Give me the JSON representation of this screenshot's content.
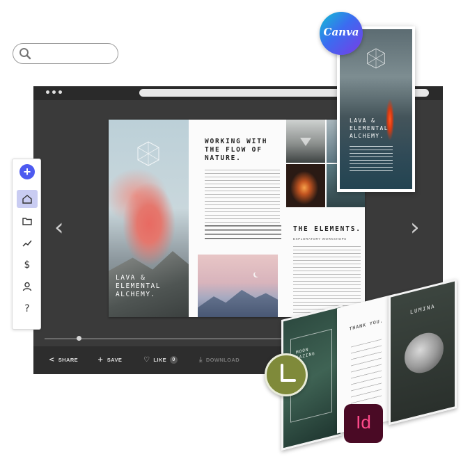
{
  "search": {
    "placeholder": ""
  },
  "spread": {
    "left_caption": [
      "LAVA &",
      "ELEMENTAL",
      "ALCHEMY."
    ],
    "heading": [
      "WORKING WITH",
      "THE FLOW OF",
      "NATURE."
    ],
    "section_title": "THE ELEMENTS.",
    "section_kicker": "EXPLORATORY WORKSHOPS"
  },
  "canva_card": {
    "caption": [
      "LAVA &",
      "ELEMENTAL",
      "ALCHEMY."
    ]
  },
  "badges": {
    "canva": "Canva",
    "indesign": "Id"
  },
  "actions": {
    "share": "SHARE",
    "save": "SAVE",
    "like": "LIKE",
    "like_count": "0",
    "download": "DOWNLOAD"
  },
  "brochure": {
    "panel1_title": [
      "MOON",
      "GAZING"
    ],
    "panel2_title": "THANK YOU.",
    "panel3_title": "LUMINA"
  },
  "icons": {
    "search": "search-icon",
    "add": "plus-icon",
    "home": "home-icon",
    "folder": "folder-icon",
    "analytics": "trend-icon",
    "billing": "dollar-icon",
    "account": "user-icon",
    "help": "question-icon"
  },
  "colors": {
    "accent": "#4d5af0",
    "viewer_bg": "#3a3a3a",
    "toolbar_active": "#c9ccf2"
  }
}
